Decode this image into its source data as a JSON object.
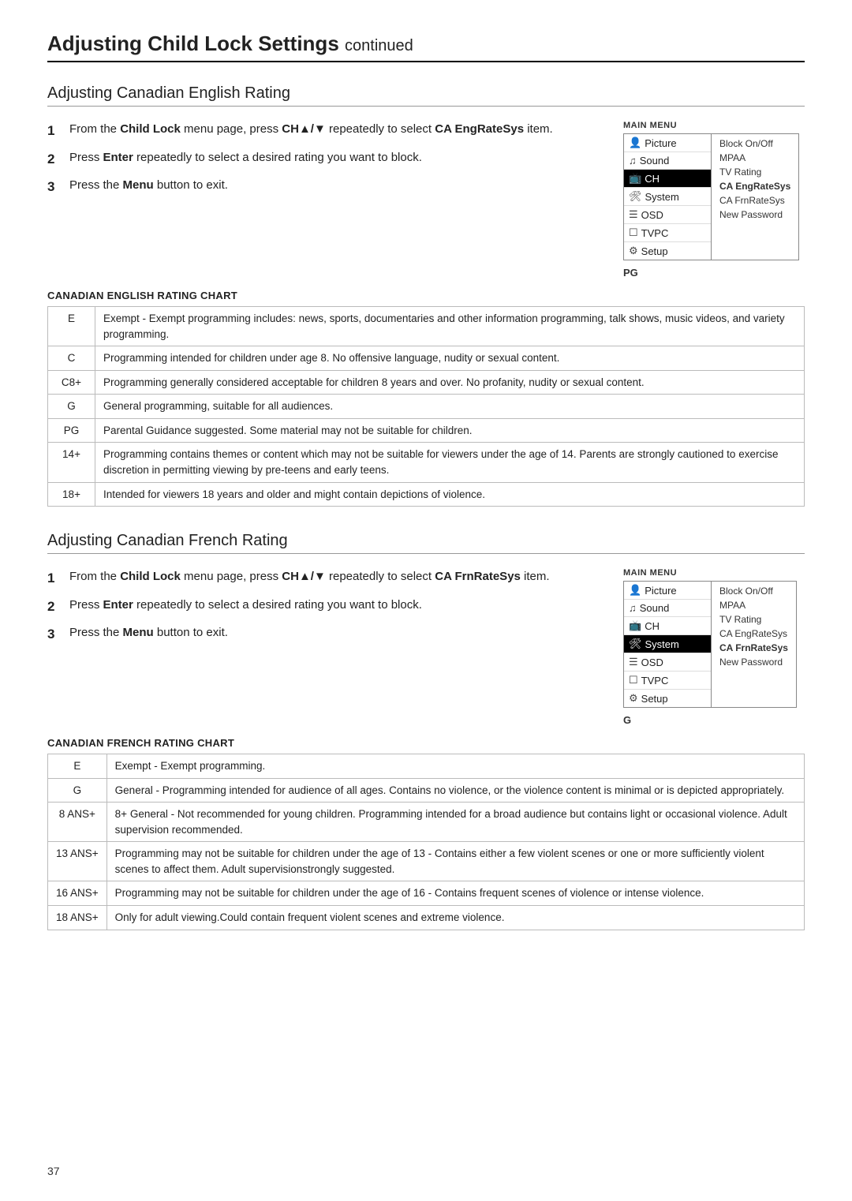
{
  "page": {
    "title": "Adjusting Child Lock Settings",
    "continued": "continued",
    "page_number": "37"
  },
  "section1": {
    "title": "Adjusting Canadian English Rating",
    "steps": [
      {
        "num": "1",
        "text_parts": [
          {
            "text": "From the ",
            "bold": false
          },
          {
            "text": "Child Lock",
            "bold": true
          },
          {
            "text": " menu page, press ",
            "bold": false
          },
          {
            "text": "CH▲/▼",
            "bold": true
          },
          {
            "text": " repeatedly to select ",
            "bold": false
          },
          {
            "text": "CA EngRateSys",
            "bold": true
          },
          {
            "text": " item.",
            "bold": false
          }
        ]
      },
      {
        "num": "2",
        "text_parts": [
          {
            "text": "Press ",
            "bold": false
          },
          {
            "text": "Enter",
            "bold": true
          },
          {
            "text": " repeatedly to select a desired rating you want to block.",
            "bold": false
          }
        ]
      },
      {
        "num": "3",
        "text_parts": [
          {
            "text": "Press the ",
            "bold": false
          },
          {
            "text": "Menu",
            "bold": true
          },
          {
            "text": "  button to exit.",
            "bold": false
          }
        ]
      }
    ],
    "menu": {
      "label": "MAIN MENU",
      "items": [
        {
          "icon": "👤",
          "label": "Picture",
          "highlighted": false
        },
        {
          "icon": "🔊",
          "label": "Sound",
          "highlighted": false
        },
        {
          "icon": "📺",
          "label": "CH",
          "highlighted": true
        },
        {
          "icon": "⚙️",
          "label": "System",
          "highlighted": false
        },
        {
          "icon": "≡",
          "label": "OSD",
          "highlighted": false
        },
        {
          "icon": "▣",
          "label": "TVPC",
          "highlighted": false
        },
        {
          "icon": "⚙",
          "label": "Setup",
          "highlighted": false
        }
      ],
      "right_items": [
        {
          "label": "Block On/Off",
          "bold": false
        },
        {
          "label": "MPAA",
          "bold": false
        },
        {
          "label": "TV Rating",
          "bold": false
        },
        {
          "label": "CA EngRateSys",
          "bold": true
        },
        {
          "label": "CA FrnRateSys",
          "bold": false
        },
        {
          "label": "New Password",
          "bold": false
        }
      ],
      "rating_display": "PG"
    },
    "chart_title": "CANADIAN ENGLISH RATING CHART",
    "chart": [
      {
        "rating": "E",
        "description": "Exempt - Exempt programming includes: news, sports, documentaries and other information programming, talk shows, music videos, and variety programming."
      },
      {
        "rating": "C",
        "description": "Programming intended for children under age 8. No offensive language, nudity or sexual content."
      },
      {
        "rating": "C8+",
        "description": "Programming generally considered acceptable for children 8 years and over. No profanity, nudity or sexual content."
      },
      {
        "rating": "G",
        "description": "General programming, suitable for all audiences."
      },
      {
        "rating": "PG",
        "description": "Parental Guidance suggested. Some material may not be suitable for children."
      },
      {
        "rating": "14+",
        "description": "Programming contains themes or content which may not be suitable for viewers under the age of 14. Parents are strongly cautioned to exercise discretion in permitting viewing by pre-teens and early teens."
      },
      {
        "rating": "18+",
        "description": "Intended for viewers 18 years and older and might contain depictions of violence."
      }
    ]
  },
  "section2": {
    "title": "Adjusting Canadian French Rating",
    "steps": [
      {
        "num": "1",
        "text_parts": [
          {
            "text": "From the ",
            "bold": false
          },
          {
            "text": "Child Lock",
            "bold": true
          },
          {
            "text": " menu page, press ",
            "bold": false
          },
          {
            "text": "CH▲/▼",
            "bold": true
          },
          {
            "text": " repeatedly to select ",
            "bold": false
          },
          {
            "text": "CA FrnRateSys",
            "bold": true
          },
          {
            "text": " item.",
            "bold": false
          }
        ]
      },
      {
        "num": "2",
        "text_parts": [
          {
            "text": "Press ",
            "bold": false
          },
          {
            "text": "Enter",
            "bold": true
          },
          {
            "text": " repeatedly to select a desired rating you want to block.",
            "bold": false
          }
        ]
      },
      {
        "num": "3",
        "text_parts": [
          {
            "text": "Press the ",
            "bold": false
          },
          {
            "text": "Menu",
            "bold": true
          },
          {
            "text": "  button to exit.",
            "bold": false
          }
        ]
      }
    ],
    "menu": {
      "label": "MAIN MENU",
      "items": [
        {
          "icon": "👤",
          "label": "Picture",
          "highlighted": false
        },
        {
          "icon": "🔊",
          "label": "Sound",
          "highlighted": false
        },
        {
          "icon": "📺",
          "label": "CH",
          "highlighted": false
        },
        {
          "icon": "⚙️",
          "label": "System",
          "highlighted": true
        },
        {
          "icon": "≡",
          "label": "OSD",
          "highlighted": false
        },
        {
          "icon": "▣",
          "label": "TVPC",
          "highlighted": false
        },
        {
          "icon": "⚙",
          "label": "Setup",
          "highlighted": false
        }
      ],
      "right_items": [
        {
          "label": "Block On/Off",
          "bold": false
        },
        {
          "label": "MPAA",
          "bold": false
        },
        {
          "label": "TV Rating",
          "bold": false
        },
        {
          "label": "CA EngRateSys",
          "bold": false
        },
        {
          "label": "CA FrnRateSys",
          "bold": true
        },
        {
          "label": "New Password",
          "bold": false
        }
      ],
      "rating_display": "G"
    },
    "chart_title": "CANADIAN FRENCH RATING CHART",
    "chart": [
      {
        "rating": "E",
        "description": "Exempt - Exempt programming."
      },
      {
        "rating": "G",
        "description": "General - Programming intended for audience of all ages. Contains no violence, or the violence content is minimal or is depicted appropriately."
      },
      {
        "rating": "8 ANS+",
        "description": "8+ General - Not recommended for young children. Programming intended for a broad audience but contains light or occasional violence. Adult supervision recommended."
      },
      {
        "rating": "13 ANS+",
        "description": "Programming may not be suitable for children under the age of 13 - Contains either a few violent scenes or one or more sufficiently violent scenes to affect them. Adult supervisionstrongly suggested."
      },
      {
        "rating": "16 ANS+",
        "description": "Programming may not be suitable for children under the age of 16 - Contains frequent scenes of violence or intense violence."
      },
      {
        "rating": "18 ANS+",
        "description": "Only for adult viewing.Could contain frequent violent scenes and extreme violence."
      }
    ]
  }
}
